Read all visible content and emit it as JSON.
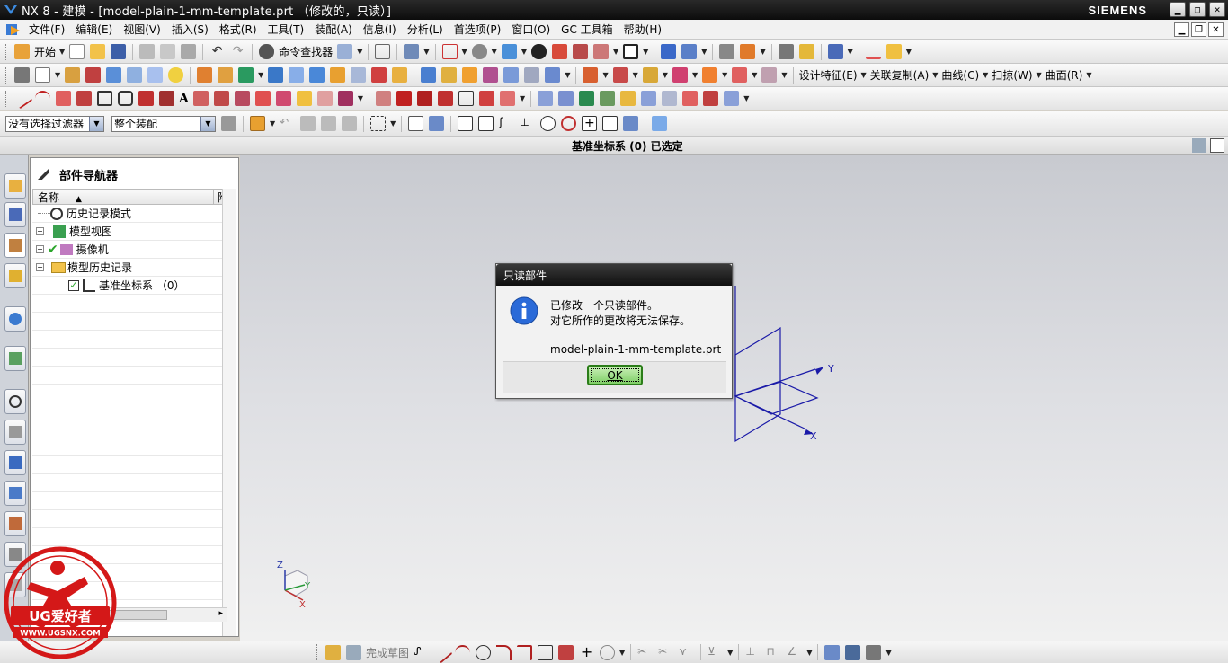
{
  "window": {
    "title": "NX 8 - 建模 - [model-plain-1-mm-template.prt （修改的，只读）]",
    "brand": "SIEMENS",
    "controls": [
      "minimize",
      "restore",
      "close"
    ]
  },
  "menubar": {
    "items": [
      "文件(F)",
      "编辑(E)",
      "视图(V)",
      "插入(S)",
      "格式(R)",
      "工具(T)",
      "装配(A)",
      "信息(I)",
      "分析(L)",
      "首选项(P)",
      "窗口(O)",
      "GC 工具箱",
      "帮助(H)"
    ]
  },
  "toolbar1": {
    "start_label": "开始",
    "finder_label": "命令查找器"
  },
  "toolbar2": {
    "labels": [
      "设计特征(E)",
      "关联复制(A)",
      "曲线(C)",
      "扫掠(W)",
      "曲面(R)"
    ]
  },
  "filterbar": {
    "filter_value": "没有选择过滤器",
    "scope_value": "整个装配"
  },
  "status": {
    "text": "基准坐标系 (0)  已选定"
  },
  "navigator": {
    "title": "部件导航器",
    "columns": [
      "名称",
      "附"
    ],
    "rows": [
      {
        "label": "历史记录模式",
        "icon": "clock-icon"
      },
      {
        "label": "模型视图",
        "icon": "model-views-icon"
      },
      {
        "label": "摄像机",
        "icon": "camera-icon"
      },
      {
        "label": "模型历史记录",
        "icon": "folder-icon"
      },
      {
        "label": "基准坐标系 （0）",
        "icon": "datum-csys-icon"
      }
    ]
  },
  "dialog": {
    "title": "只读部件",
    "line1": "已修改一个只读部件。",
    "line2": "对它所作的更改将无法保存。",
    "filename": "model-plain-1-mm-template.prt",
    "ok_label": "OK"
  },
  "csys": {
    "axis_x": "X",
    "axis_y": "Y",
    "axis_z": "Z"
  },
  "bottombar": {
    "finish_sketch": "完成草图"
  },
  "watermark": {
    "brand": "UG爱好者",
    "url": "WWW.UGSNX.COM"
  },
  "colors": {
    "csys_blue": "#1a1aa8",
    "ok_green": "#7fce66",
    "check_green": "#2aa52a"
  }
}
